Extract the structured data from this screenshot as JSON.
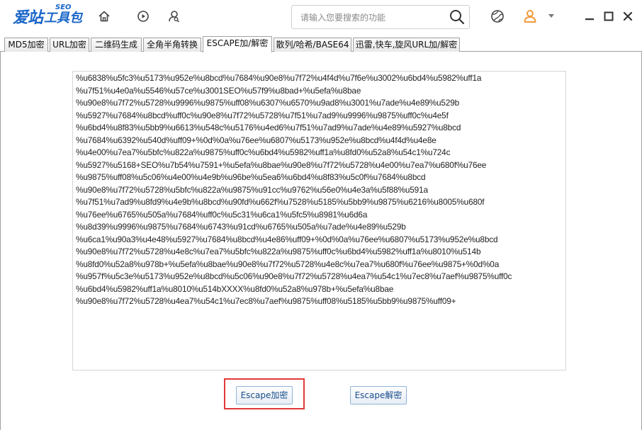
{
  "app": {
    "logo_main": "爱站",
    "logo_seo": "SEO",
    "logo_sub": "工具包"
  },
  "toolbar": {
    "icons": [
      "home-icon",
      "play-icon",
      "user-search-icon"
    ]
  },
  "search": {
    "placeholder": "请输入您要搜索的功能",
    "value": ""
  },
  "titlebar_right": {
    "icons": [
      "globe-icon",
      "user-avatar-icon",
      "dropdown-arrow-icon",
      "minimize-icon",
      "maximize-icon",
      "close-icon"
    ]
  },
  "tabs": [
    {
      "label": "MD5加密",
      "active": false
    },
    {
      "label": "URL加密",
      "active": false
    },
    {
      "label": "二维码生成",
      "active": false
    },
    {
      "label": "全角半角转换",
      "active": false
    },
    {
      "label": "ESCAPE加/解密",
      "active": true
    },
    {
      "label": "散列/哈希/BASE64",
      "active": false
    },
    {
      "label": "迅雷,快车,旋风URL加/解密",
      "active": false
    }
  ],
  "editor": {
    "lines": [
      "%u6838%u5fc3%u5173%u952e%u8bcd%u7684%u90e8%u7f72%u4f4d%u7f6e%u3002%u6bd4%u5982%uff1a",
      "%u7f51%u4e0a%u5546%u57ce%u3001SEO%u57f9%u8bad+%u5efa%u8bae",
      "%u90e8%u7f72%u5728%u9996%u9875%uff08%u6307%u6570%u9ad8%u3001%u7ade%u4e89%u529b",
      "%u5927%u7684%u8bcd%uff0c%u90e8%u7f72%u5728%u7f51%u7ad9%u9996%u9875%uff0c%u4e5f",
      "%u6bd4%u8f83%u5bb9%u6613%u548c%u5176%u4ed6%u7f51%u7ad9%u7ade%u4e89%u5927%u8bcd",
      "%u7684%u6392%u540d%uff09+%0d%0a%u76ee%u6807%u5173%u952e%u8bcd%u4f4d%u4e8e",
      "%u4e00%u7ea7%u5bfc%u822a%u9875%uff0c%u6bd4%u5982%uff1a%u8fd0%u52a8%u54c1%u724c",
      "%u5927%u5168+SEO%u7b54%u7591+%u5efa%u8bae%u90e8%u7f72%u5728%u4e00%u7ea7%u680f%u76ee",
      "%u9875%uff08%u5c06%u4e00%u4e9b%u96be%u5ea6%u6bd4%u8f83%u5c0f%u7684%u8bcd",
      "%u90e8%u7f72%u5728%u5bfc%u822a%u9875%u91cc%u9762%u56e0%u4e3a%u5f88%u591a",
      "%u7f51%u7ad9%u8fd9%u4e9b%u8bcd%u90fd%u662f%u7528%u5185%u5bb9%u9875%u6216%u8005%u680f",
      "%u76ee%u6765%u505a%u7684%uff0c%u5c31%u6ca1%u5fc5%u8981%u6d6a",
      "%u8d39%u9996%u9875%u7684%u6743%u91cd%u6765%u505a%u7ade%u4e89%u529b",
      "%u6ca1%u90a3%u4e48%u5927%u7684%u8bcd%u4e86%uff09+%0d%0a%u76ee%u6807%u5173%u952e%u8bcd",
      "%u90e8%u7f72%u5728%u4e8c%u7ea7%u5bfc%u822a%u9875%uff0c%u6bd4%u5982%uff1a%u8010%u514b",
      "%u8fd0%u52a8%u978b+%u5efa%u8bae%u90e8%u7f72%u5728%u4e8c%u7ea7%u680f%u76ee%u9875+%0d%0a",
      "%u957f%u5c3e%u5173%u952e%u8bcd%u5c06%u90e8%u7f72%u5728%u4ea7%u54c1%u7ec8%u7aef%u9875%uff0c",
      "%u6bd4%u5982%uff1a%u8010%u514bXXXX%u8fd0%u52a8%u978b+%u5efa%u8bae",
      "%u90e8%u7f72%u5728%u4ea7%u54c1%u7ec8%u7aef%u9875%uff08%u5185%u5bb9%u9875%uff09+"
    ]
  },
  "buttons": {
    "encrypt_label": "Escape加密",
    "decrypt_label": "Escape解密"
  },
  "colors": {
    "brand": "#1a66c9",
    "highlight": "#e23838",
    "avatar": "#f39a3d"
  }
}
